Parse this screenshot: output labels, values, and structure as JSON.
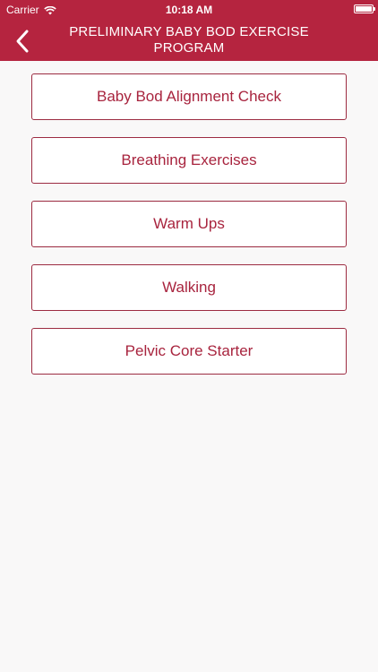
{
  "status_bar": {
    "carrier": "Carrier",
    "time": "10:18 AM",
    "wifi_icon": "wifi-icon",
    "battery_icon": "battery-full-icon"
  },
  "header": {
    "title": "PRELIMINARY BABY BOD EXERCISE PROGRAM",
    "back_icon": "chevron-left-icon",
    "background_color": "#b5243f",
    "text_color": "#ffffff"
  },
  "menu": {
    "items": [
      {
        "label": "Baby Bod Alignment Check"
      },
      {
        "label": "Breathing Exercises"
      },
      {
        "label": "Warm Ups"
      },
      {
        "label": "Walking"
      },
      {
        "label": "Pelvic Core Starter"
      }
    ],
    "accent_color": "#a8243e",
    "background_color": "#f9f8f8"
  }
}
